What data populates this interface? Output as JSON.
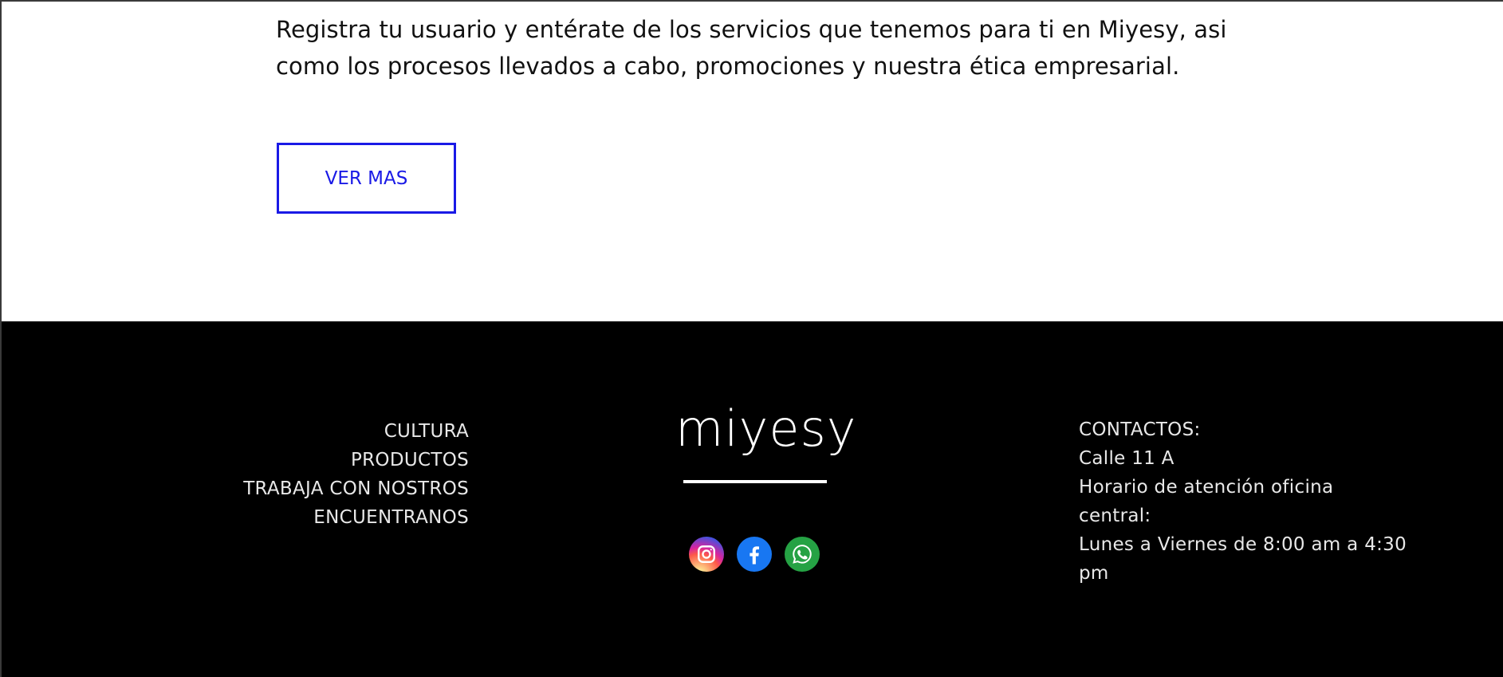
{
  "intro": {
    "line1": "Registra tu usuario y entérate de los servicios que tenemos para ti en Miyesy, asi",
    "line2": "como los procesos llevados a cabo, promociones y nuestra ética empresarial."
  },
  "cta": {
    "label": "VER MAS",
    "color": "#1a1ae6"
  },
  "footer": {
    "nav": [
      {
        "label": "CULTURA"
      },
      {
        "label": "PRODUCTOS"
      },
      {
        "label": "TRABAJA CON NOSTROS"
      },
      {
        "label": "ENCUENTRANOS"
      }
    ],
    "brand": "miyesy",
    "socials": [
      {
        "icon": "instagram-icon"
      },
      {
        "icon": "facebook-icon"
      },
      {
        "icon": "whatsapp-icon"
      }
    ],
    "contact": {
      "heading": "CONTACTOS:",
      "address": "Calle 11 A",
      "hours_label_1": "Horario de atención oficina",
      "hours_label_2": "central:",
      "hours_1": "Lunes a Viernes de 8:00 am a 4:30",
      "hours_2": "pm"
    },
    "background": "#000000"
  }
}
